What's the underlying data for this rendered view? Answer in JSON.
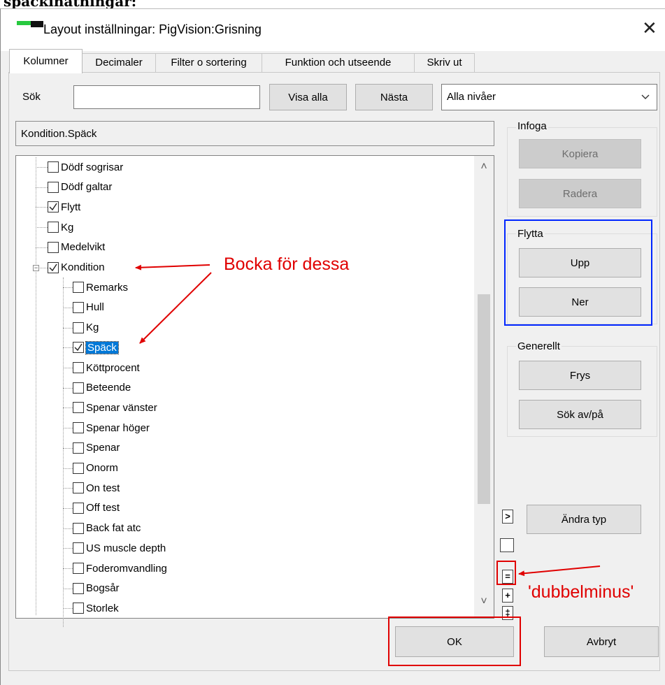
{
  "top_clip_text": "spackinatningar:",
  "window": {
    "title": "Layout inställningar: PigVision:Grisning",
    "close_glyph": "✕"
  },
  "tabs": [
    {
      "label": "Kolumner",
      "active": true
    },
    {
      "label": "Decimaler",
      "active": false
    },
    {
      "label": "Filter o sortering",
      "active": false
    },
    {
      "label": "Funktion och utseende",
      "active": false
    },
    {
      "label": "Skriv ut",
      "active": false
    }
  ],
  "search": {
    "label": "Sök",
    "value": "",
    "show_all_label": "Visa alla",
    "next_label": "Nästa",
    "level_select_value": "Alla nivåer"
  },
  "path_display": "Kondition.Späck",
  "tree": {
    "items": [
      {
        "label": "Dödf sogrisar",
        "checked": false,
        "level": 1
      },
      {
        "label": "Dödf galtar",
        "checked": false,
        "level": 1
      },
      {
        "label": "Flytt",
        "checked": true,
        "level": 1
      },
      {
        "label": "Kg",
        "checked": false,
        "level": 1
      },
      {
        "label": "Medelvikt",
        "checked": false,
        "level": 1
      },
      {
        "label": "Kondition",
        "checked": true,
        "level": 1,
        "expanded": true
      },
      {
        "label": "Remarks",
        "checked": false,
        "level": 2
      },
      {
        "label": "Hull",
        "checked": false,
        "level": 2
      },
      {
        "label": "Kg",
        "checked": false,
        "level": 2
      },
      {
        "label": "Späck",
        "checked": true,
        "level": 2,
        "selected": true
      },
      {
        "label": "Köttprocent",
        "checked": false,
        "level": 2
      },
      {
        "label": "Beteende",
        "checked": false,
        "level": 2
      },
      {
        "label": "Spenar vänster",
        "checked": false,
        "level": 2
      },
      {
        "label": "Spenar höger",
        "checked": false,
        "level": 2
      },
      {
        "label": "Spenar",
        "checked": false,
        "level": 2
      },
      {
        "label": "Onorm",
        "checked": false,
        "level": 2
      },
      {
        "label": "On test",
        "checked": false,
        "level": 2
      },
      {
        "label": "Off test",
        "checked": false,
        "level": 2
      },
      {
        "label": "Back fat atc",
        "checked": false,
        "level": 2
      },
      {
        "label": "US muscle depth",
        "checked": false,
        "level": 2
      },
      {
        "label": "Foderomvandling",
        "checked": false,
        "level": 2
      },
      {
        "label": "Bogsår",
        "checked": false,
        "level": 2
      },
      {
        "label": "Storlek",
        "checked": false,
        "level": 2
      }
    ],
    "expander_glyph": "−",
    "scroll_up_glyph": "˄",
    "scroll_down_glyph": "˅"
  },
  "groups": {
    "infoga": {
      "title": "Infoga",
      "copy_label": "Kopiera",
      "delete_label": "Radera"
    },
    "flytta": {
      "title": "Flytta",
      "up_label": "Upp",
      "down_label": "Ner"
    },
    "generellt": {
      "title": "Generellt",
      "freeze_label": "Frys",
      "search_toggle_label": "Sök av/på"
    }
  },
  "side_buttons": {
    "arrow_glyph": ">",
    "change_type_label": "Ändra typ",
    "equals_glyph": "=",
    "plus_glyph": "+",
    "double_plus_glyph": "‡"
  },
  "footer": {
    "ok_label": "OK",
    "cancel_label": "Avbryt"
  },
  "annotations": {
    "bocka": "Bocka för dessa",
    "dubbelminus": "'dubbelminus'",
    "color": "#e00000",
    "highlight_blue": "#0026ff"
  }
}
